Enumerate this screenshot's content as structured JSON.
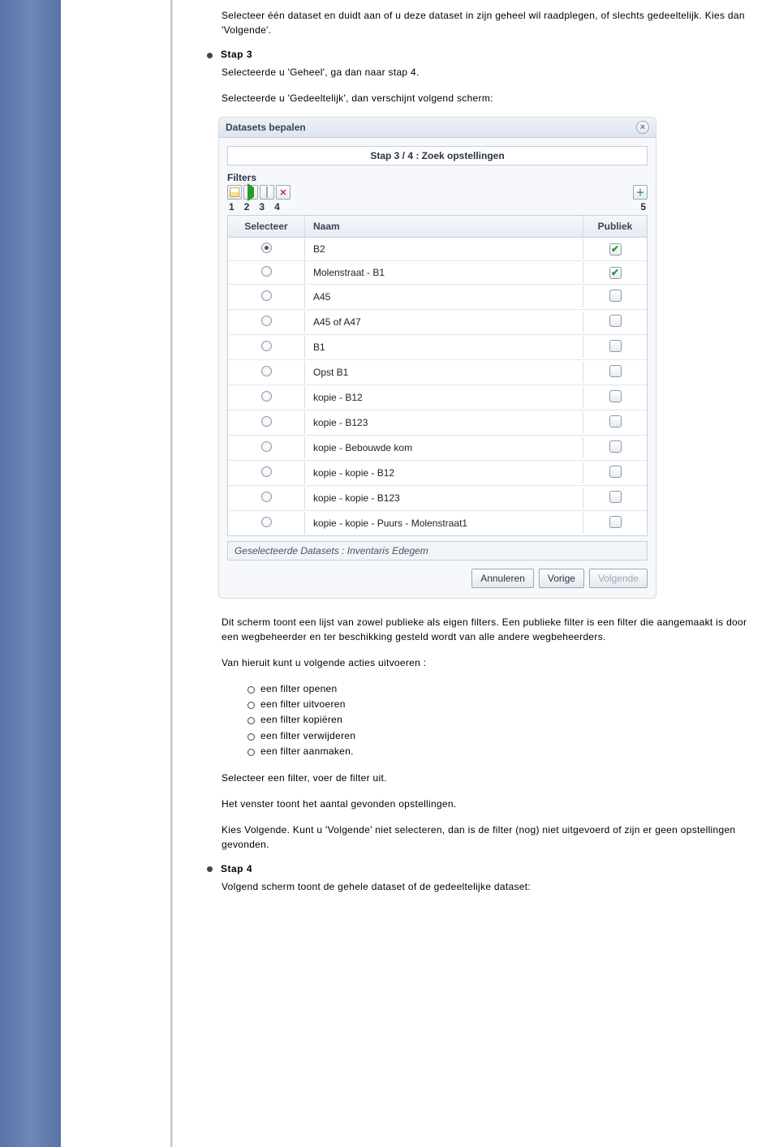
{
  "intro_p1": "Selecteer één dataset en duidt aan of u deze dataset in zijn geheel wil raadplegen, of slechts gedeeltelijk. Kies dan 'Volgende'.",
  "step3_title": "Stap 3",
  "step3_p1": "Selecteerde u 'Geheel', ga dan naar stap 4.",
  "step3_p2": "Selecteerde u 'Gedeeltelijk', dan verschijnt volgend scherm:",
  "dialog": {
    "title": "Datasets bepalen",
    "step_banner": "Stap 3 / 4 : Zoek opstellingen",
    "filters_label": "Filters",
    "nums_left": [
      "1",
      "2",
      "3",
      "4"
    ],
    "nums_right": "5",
    "headers": {
      "selecteer": "Selecteer",
      "naam": "Naam",
      "publiek": "Publiek"
    },
    "rows": [
      {
        "selected": true,
        "naam": "B2",
        "publiek": true
      },
      {
        "selected": false,
        "naam": "Molenstraat - B1",
        "publiek": true
      },
      {
        "selected": false,
        "naam": "A45",
        "publiek": false
      },
      {
        "selected": false,
        "naam": "A45 of A47",
        "publiek": false
      },
      {
        "selected": false,
        "naam": "B1",
        "publiek": false
      },
      {
        "selected": false,
        "naam": "Opst B1",
        "publiek": false
      },
      {
        "selected": false,
        "naam": "kopie - B12",
        "publiek": false
      },
      {
        "selected": false,
        "naam": "kopie - B123",
        "publiek": false
      },
      {
        "selected": false,
        "naam": "kopie - Bebouwde kom",
        "publiek": false
      },
      {
        "selected": false,
        "naam": "kopie - kopie - B12",
        "publiek": false
      },
      {
        "selected": false,
        "naam": "kopie - kopie - B123",
        "publiek": false
      },
      {
        "selected": false,
        "naam": "kopie - kopie - Puurs - Molenstraat1",
        "publiek": false
      }
    ],
    "selected_footer": "Geselecteerde Datasets : Inventaris Edegem",
    "buttons": {
      "annuleren": "Annuleren",
      "vorige": "Vorige",
      "volgende": "Volgende"
    }
  },
  "after_p1": "Dit scherm toont een lijst van zowel publieke als eigen filters. Een publieke filter is een filter die aangemaakt is door een wegbeheerder en ter beschikking gesteld wordt van alle andere wegbeheerders.",
  "after_p2": "Van hieruit kunt u volgende acties uitvoeren :",
  "actions": [
    "een filter openen",
    "een filter uitvoeren",
    "een filter kopiëren",
    "een filter verwijderen",
    "een filter aanmaken."
  ],
  "after_p3": "Selecteer een filter, voer de filter uit.",
  "after_p4": "Het venster toont het aantal gevonden opstellingen.",
  "after_p5": "Kies Volgende. Kunt u 'Volgende' niet selecteren, dan is de filter (nog) niet uitgevoerd of zijn er geen opstellingen gevonden.",
  "step4_title": "Stap 4",
  "step4_p1": "Volgend scherm toont de gehele dataset of de gedeeltelijke dataset:"
}
